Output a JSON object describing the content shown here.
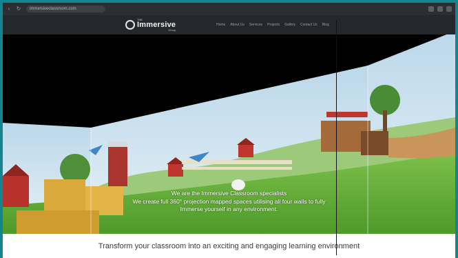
{
  "browser": {
    "url": "immersiveclassroom.com"
  },
  "site": {
    "logo_top": "THE",
    "logo_main": "Immersive",
    "logo_sub": "Group",
    "menu": [
      "Home",
      "About Us",
      "Services",
      "Projects",
      "Gallery",
      "Contact Us",
      "Blog"
    ]
  },
  "hero": {
    "line1": "We are the Immersive Classroom specialists",
    "line2": "We create full 360° projection mapped spaces utilising all four walls to fully",
    "line3": "Immerse yourself in any environment."
  },
  "tagline": "Transform your classroom into an exciting and engaging learning environment"
}
